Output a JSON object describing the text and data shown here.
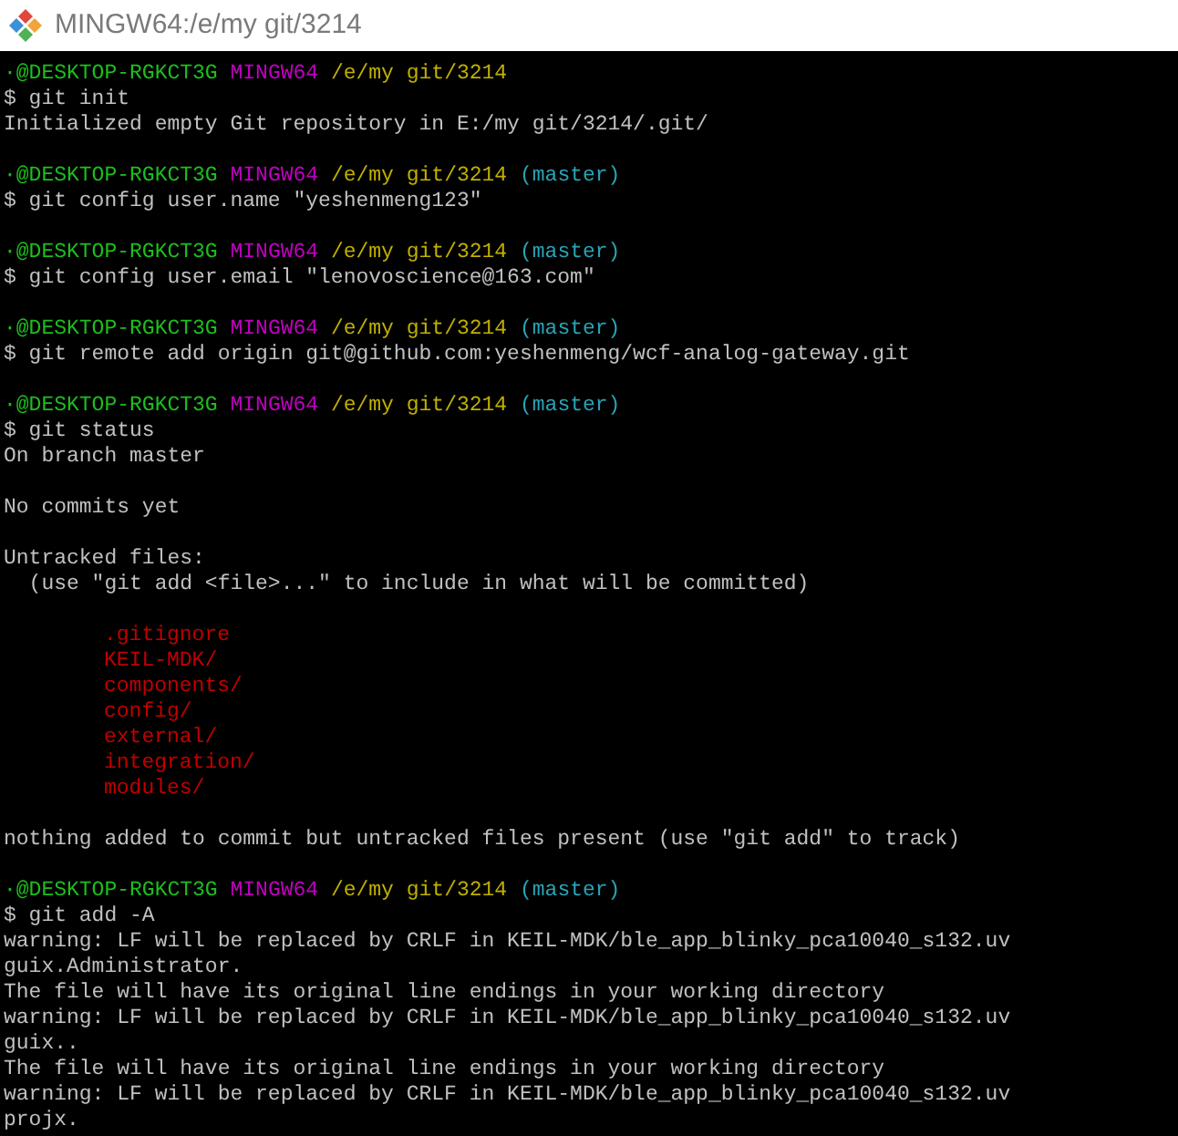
{
  "window": {
    "title": "MINGW64:/e/my git/3214"
  },
  "lines": [
    {
      "kind": "prompt",
      "user_host": "·@DESKTOP-RGKCT3G",
      "system": "MINGW64",
      "path": "/e/my git/3214"
    },
    {
      "kind": "command",
      "text": "$ git init"
    },
    {
      "kind": "output",
      "text": "Initialized empty Git repository in E:/my git/3214/.git/"
    },
    {
      "kind": "blank"
    },
    {
      "kind": "prompt",
      "user_host": "·@DESKTOP-RGKCT3G",
      "system": "MINGW64",
      "path": "/e/my git/3214",
      "branch": "(master)"
    },
    {
      "kind": "command",
      "text": "$ git config user.name \"yeshenmeng123\""
    },
    {
      "kind": "blank"
    },
    {
      "kind": "prompt",
      "user_host": "·@DESKTOP-RGKCT3G",
      "system": "MINGW64",
      "path": "/e/my git/3214",
      "branch": "(master)"
    },
    {
      "kind": "command",
      "text": "$ git config user.email \"lenovoscience@163.com\""
    },
    {
      "kind": "blank"
    },
    {
      "kind": "prompt",
      "user_host": "·@DESKTOP-RGKCT3G",
      "system": "MINGW64",
      "path": "/e/my git/3214",
      "branch": "(master)"
    },
    {
      "kind": "command",
      "text": "$ git remote add origin git@github.com:yeshenmeng/wcf-analog-gateway.git"
    },
    {
      "kind": "blank"
    },
    {
      "kind": "prompt",
      "user_host": "·@DESKTOP-RGKCT3G",
      "system": "MINGW64",
      "path": "/e/my git/3214",
      "branch": "(master)"
    },
    {
      "kind": "command",
      "text": "$ git status"
    },
    {
      "kind": "output",
      "text": "On branch master"
    },
    {
      "kind": "blank"
    },
    {
      "kind": "output",
      "text": "No commits yet"
    },
    {
      "kind": "blank"
    },
    {
      "kind": "output",
      "text": "Untracked files:"
    },
    {
      "kind": "output",
      "text": "  (use \"git add <file>...\" to include in what will be committed)"
    },
    {
      "kind": "blank"
    },
    {
      "kind": "untracked",
      "text": ".gitignore"
    },
    {
      "kind": "untracked",
      "text": "KEIL-MDK/"
    },
    {
      "kind": "untracked",
      "text": "components/"
    },
    {
      "kind": "untracked",
      "text": "config/"
    },
    {
      "kind": "untracked",
      "text": "external/"
    },
    {
      "kind": "untracked",
      "text": "integration/"
    },
    {
      "kind": "untracked",
      "text": "modules/"
    },
    {
      "kind": "blank"
    },
    {
      "kind": "output",
      "text": "nothing added to commit but untracked files present (use \"git add\" to track)"
    },
    {
      "kind": "blank"
    },
    {
      "kind": "prompt",
      "user_host": "·@DESKTOP-RGKCT3G",
      "system": "MINGW64",
      "path": "/e/my git/3214",
      "branch": "(master)"
    },
    {
      "kind": "command",
      "text": "$ git add -A"
    },
    {
      "kind": "output",
      "text": "warning: LF will be replaced by CRLF in KEIL-MDK/ble_app_blinky_pca10040_s132.uv"
    },
    {
      "kind": "output",
      "text": "guix.Administrator."
    },
    {
      "kind": "output",
      "text": "The file will have its original line endings in your working directory"
    },
    {
      "kind": "output",
      "text": "warning: LF will be replaced by CRLF in KEIL-MDK/ble_app_blinky_pca10040_s132.uv"
    },
    {
      "kind": "output",
      "text": "guix.."
    },
    {
      "kind": "output",
      "text": "The file will have its original line endings in your working directory"
    },
    {
      "kind": "output",
      "text": "warning: LF will be replaced by CRLF in KEIL-MDK/ble_app_blinky_pca10040_s132.uv"
    },
    {
      "kind": "output",
      "text": "projx."
    }
  ]
}
